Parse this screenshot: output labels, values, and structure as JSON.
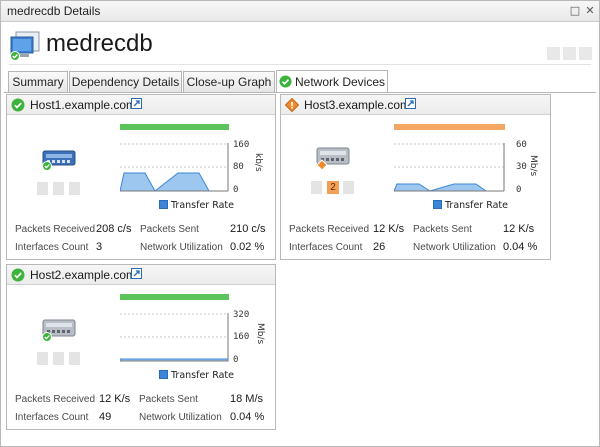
{
  "window": {
    "title": "medrecdb Details"
  },
  "header": {
    "title": "medrecdb"
  },
  "tabs": [
    {
      "label": "Summary"
    },
    {
      "label": "Dependency Details"
    },
    {
      "label": "Close-up Graph"
    },
    {
      "label": "Network Devices"
    }
  ],
  "colors": {
    "ok": "#3db33d",
    "warning": "#f29a4a",
    "series": "#3b86d8"
  },
  "devices": [
    {
      "host": "Host1.example.com",
      "status": "ok",
      "chart": {
        "max_label": "160",
        "mid_label": "80",
        "min_label": "0",
        "unit": "kb/s",
        "legend": "Transfer Rate"
      },
      "stats": {
        "packets_received_label": "Packets Received",
        "packets_received": "208 c/s",
        "packets_sent_label": "Packets Sent",
        "packets_sent": "210 c/s",
        "interfaces_label": "Interfaces Count",
        "interfaces": "3",
        "utilization_label": "Network Utilization",
        "utilization": "0.02 %"
      }
    },
    {
      "host": "Host3.example.com",
      "status": "warning",
      "alert_count": "2",
      "chart": {
        "max_label": "60",
        "mid_label": "30",
        "min_label": "0",
        "unit": "Mb/s",
        "legend": "Transfer Rate"
      },
      "stats": {
        "packets_received_label": "Packets Received",
        "packets_received": "12 K/s",
        "packets_sent_label": "Packets Sent",
        "packets_sent": "12 K/s",
        "interfaces_label": "Interfaces Count",
        "interfaces": "26",
        "utilization_label": "Network Utilization",
        "utilization": "0.04 %"
      }
    },
    {
      "host": "Host2.example.com",
      "status": "ok",
      "chart": {
        "max_label": "320",
        "mid_label": "160",
        "min_label": "0",
        "unit": "Mb/s",
        "legend": "Transfer Rate"
      },
      "stats": {
        "packets_received_label": "Packets Received",
        "packets_received": "12 K/s",
        "packets_sent_label": "Packets Sent",
        "packets_sent": "18 M/s",
        "interfaces_label": "Interfaces Count",
        "interfaces": "49",
        "utilization_label": "Network Utilization",
        "utilization": "0.04 %"
      }
    }
  ]
}
